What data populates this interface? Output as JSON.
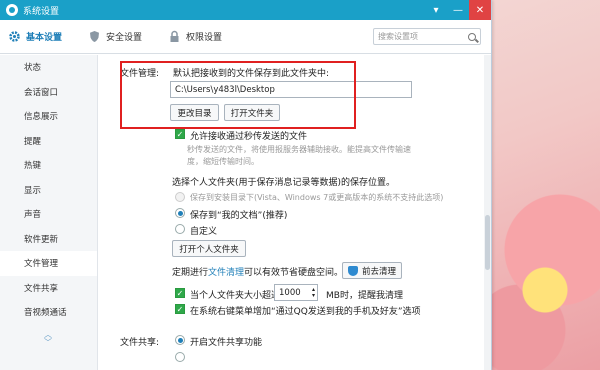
{
  "window": {
    "title": "系统设置"
  },
  "tabs": [
    {
      "label": "基本设置"
    },
    {
      "label": "安全设置"
    },
    {
      "label": "权限设置"
    }
  ],
  "search": {
    "placeholder": "搜索设置项"
  },
  "sidebar": {
    "items": [
      {
        "label": "状态"
      },
      {
        "label": "会话窗口"
      },
      {
        "label": "信息展示"
      },
      {
        "label": "提醒"
      },
      {
        "label": "热键"
      },
      {
        "label": "显示"
      },
      {
        "label": "声音"
      },
      {
        "label": "软件更新"
      },
      {
        "label": "文件管理"
      },
      {
        "label": "文件共享"
      },
      {
        "label": "音视频通话"
      }
    ]
  },
  "file_mgmt": {
    "section_label": "文件管理:",
    "save_desc": "默认把接收到的文件保存到此文件夹中:",
    "path": "C:\\Users\\y483l\\Desktop",
    "change_dir": "更改目录",
    "open_folder": "打开文件夹",
    "allow_p2p": "允许接收通过秒传发送的文件",
    "p2p_desc1": "秒传发送的文件，将使用报服务器辅助接收。能提高文件传输速",
    "p2p_desc2": "度，缩短传输时间。",
    "personal_folder_title": "选择个人文件夹(用于保存消息记录等数据)的保存位置。",
    "opt_install": "保存到安装目录下(Vista、Windows 7或更高版本的系统不支持此选项)",
    "opt_docs": "保存到“我的文档”(推荐)",
    "opt_custom": "自定义",
    "open_personal": "打开个人文件夹",
    "cleanup_pre": "定期进行",
    "cleanup_link": "文件清理",
    "cleanup_post": "可以有效节省硬盘空间。",
    "cleanup_btn": "前去清理",
    "size_pre": "当个人文件夹大小超过",
    "size_value": "1000",
    "size_post": "MB时，提醒我清理",
    "rightclick": "在系统右键菜单增加“通过QQ发送到我的手机及好友”选项"
  },
  "file_share": {
    "section_label": "文件共享:",
    "enable": "开启文件共享功能"
  }
}
